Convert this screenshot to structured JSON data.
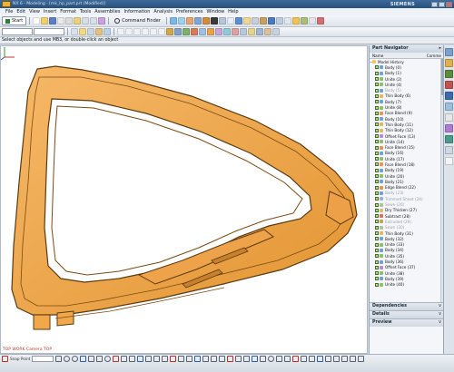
{
  "window": {
    "title": "NX 6 - Modeling - [mk_hp_part.prt (Modified)]",
    "brand": "SIEMENS",
    "buttons": [
      "minimize",
      "maximize",
      "close"
    ]
  },
  "menu": [
    "File",
    "Edit",
    "View",
    "Insert",
    "Format",
    "Tools",
    "Assemblies",
    "Information",
    "Analysis",
    "Preferences",
    "Window",
    "Help"
  ],
  "toolbar": {
    "start_label": "Start",
    "command_finder_label": "Command Finder"
  },
  "status_prompt": "Select objects and use MB3, or double-click an object",
  "viewport": {
    "camera_label": "TOP WORK Camera TOP",
    "model_fill": "#f0a84a",
    "model_stroke": "#5a3a12"
  },
  "navigator": {
    "title": "Part Navigator",
    "col_name": "Name",
    "col_comment": "Comme",
    "root": "Model History",
    "items": [
      {
        "label": "Body (0)",
        "icon": "body-icon",
        "dim": false
      },
      {
        "label": "Body (1)",
        "icon": "body-icon",
        "dim": false
      },
      {
        "label": "Unite (2)",
        "icon": "unite-icon",
        "dim": false
      },
      {
        "label": "Unite (4)",
        "icon": "unite-icon",
        "dim": false
      },
      {
        "label": "Body (5)",
        "icon": "body-icon",
        "dim": true
      },
      {
        "label": "Thin Body (6)",
        "icon": "thin-body-icon",
        "dim": false
      },
      {
        "label": "Body (7)",
        "icon": "body-icon",
        "dim": false
      },
      {
        "label": "Unite (8)",
        "icon": "unite-icon",
        "dim": false
      },
      {
        "label": "Face Blend (9)",
        "icon": "blend-icon",
        "dim": false
      },
      {
        "label": "Body (10)",
        "icon": "body-icon",
        "dim": false
      },
      {
        "label": "Thin Body (11)",
        "icon": "thin-body-icon",
        "dim": false
      },
      {
        "label": "Thin Body (12)",
        "icon": "thin-body-icon",
        "dim": false
      },
      {
        "label": "Offset Face (13)",
        "icon": "offset-icon",
        "dim": false
      },
      {
        "label": "Unite (14)",
        "icon": "unite-icon",
        "dim": false
      },
      {
        "label": "Face Blend (15)",
        "icon": "blend-icon",
        "dim": false
      },
      {
        "label": "Body (16)",
        "icon": "body-icon",
        "dim": false
      },
      {
        "label": "Unite (17)",
        "icon": "unite-icon",
        "dim": false
      },
      {
        "label": "Face Blend (18)",
        "icon": "blend-icon",
        "dim": false
      },
      {
        "label": "Body (19)",
        "icon": "body-icon",
        "dim": false
      },
      {
        "label": "Unite (20)",
        "icon": "unite-icon",
        "dim": false
      },
      {
        "label": "Body (21)",
        "icon": "body-icon",
        "dim": false
      },
      {
        "label": "Edge Blend (22)",
        "icon": "blend-icon",
        "dim": false
      },
      {
        "label": "Body (23)",
        "icon": "body-icon",
        "dim": true
      },
      {
        "label": "Trimmed Sheet (24)",
        "icon": "sheet-icon",
        "dim": true
      },
      {
        "label": "Sewn (26)",
        "icon": "sewn-icon",
        "dim": true
      },
      {
        "label": "Dry Thicken (27)",
        "icon": "thicken-icon",
        "dim": false
      },
      {
        "label": "Subtract (28)",
        "icon": "subtract-icon",
        "dim": false
      },
      {
        "label": "Extruded (29)",
        "icon": "extrude-icon",
        "dim": true
      },
      {
        "label": "Sewn (30)",
        "icon": "sewn-icon",
        "dim": true
      },
      {
        "label": "Thin Body (31)",
        "icon": "thin-body-icon",
        "dim": false
      },
      {
        "label": "Body (32)",
        "icon": "body-icon",
        "dim": false
      },
      {
        "label": "Unite (33)",
        "icon": "unite-icon",
        "dim": false
      },
      {
        "label": "Body (34)",
        "icon": "body-icon",
        "dim": false
      },
      {
        "label": "Unite (35)",
        "icon": "unite-icon",
        "dim": false
      },
      {
        "label": "Body (36)",
        "icon": "body-icon",
        "dim": false
      },
      {
        "label": "Offset Face (37)",
        "icon": "offset-icon",
        "dim": false
      },
      {
        "label": "Unite (38)",
        "icon": "unite-icon",
        "dim": false
      },
      {
        "label": "Body (39)",
        "icon": "body-icon",
        "dim": false
      },
      {
        "label": "Unite (40)",
        "icon": "unite-icon",
        "dim": false
      }
    ],
    "sections": [
      "Dependencies",
      "Details",
      "Preview"
    ]
  },
  "bottombar": {
    "snap_label": "Snap Point"
  }
}
